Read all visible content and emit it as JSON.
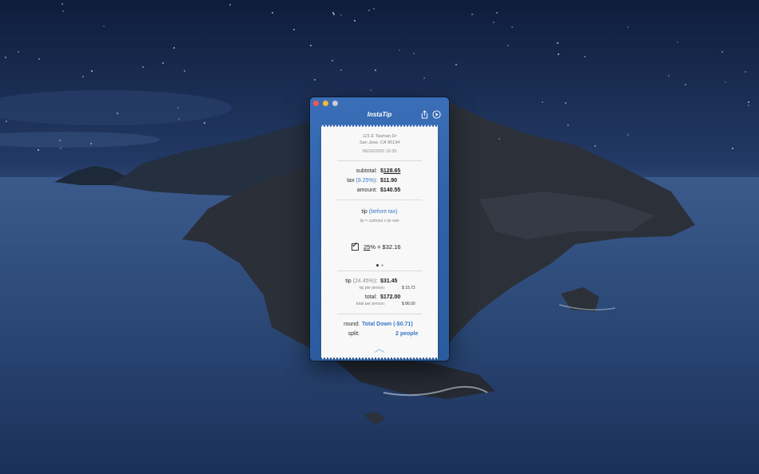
{
  "app": {
    "title": "InstaTip",
    "icons": {
      "share": "share-icon",
      "play": "play-icon"
    }
  },
  "receipt": {
    "address_line1": "121 E Tasman Dr",
    "address_line2": "San Jose, CA 95134",
    "datetime": "06/29/2020 16:35",
    "subtotal_label": "subtotal:",
    "subtotal_currency": "$",
    "subtotal_value": "128.65",
    "tax_label": "tax",
    "tax_rate": "(9.25%)",
    "tax_colon": ":",
    "tax_value": "$11.90",
    "amount_label": "amount:",
    "amount_value": "$140.55",
    "tip_label": "tip",
    "tip_mode": "(before tax)",
    "tip_formula": "tip = subtotal x tip rate",
    "tip_checked": true,
    "tip_percent": "25",
    "tip_rate_suffix": "% = $32.16",
    "page_indicator": {
      "current": 1,
      "total": 2
    },
    "tip_total_label": "tip",
    "tip_effective_rate": "(24.45%)",
    "tip_total_colon": ":",
    "tip_total_value": "$31.45",
    "tip_per_person_label": "tip per person:",
    "tip_per_person_value": "$ 15.72",
    "total_label": "total:",
    "total_value": "$172.00",
    "total_per_person_label": "total per person:",
    "total_per_person_value": "$ 86.00",
    "round_label": "round:",
    "round_value": "Total Down (-$0.71)",
    "split_label": "split:",
    "split_value": "2 people"
  },
  "colors": {
    "accent": "#3a78c9",
    "window_blue": "#2f62a8",
    "receipt_bg": "#f7f8f7"
  }
}
